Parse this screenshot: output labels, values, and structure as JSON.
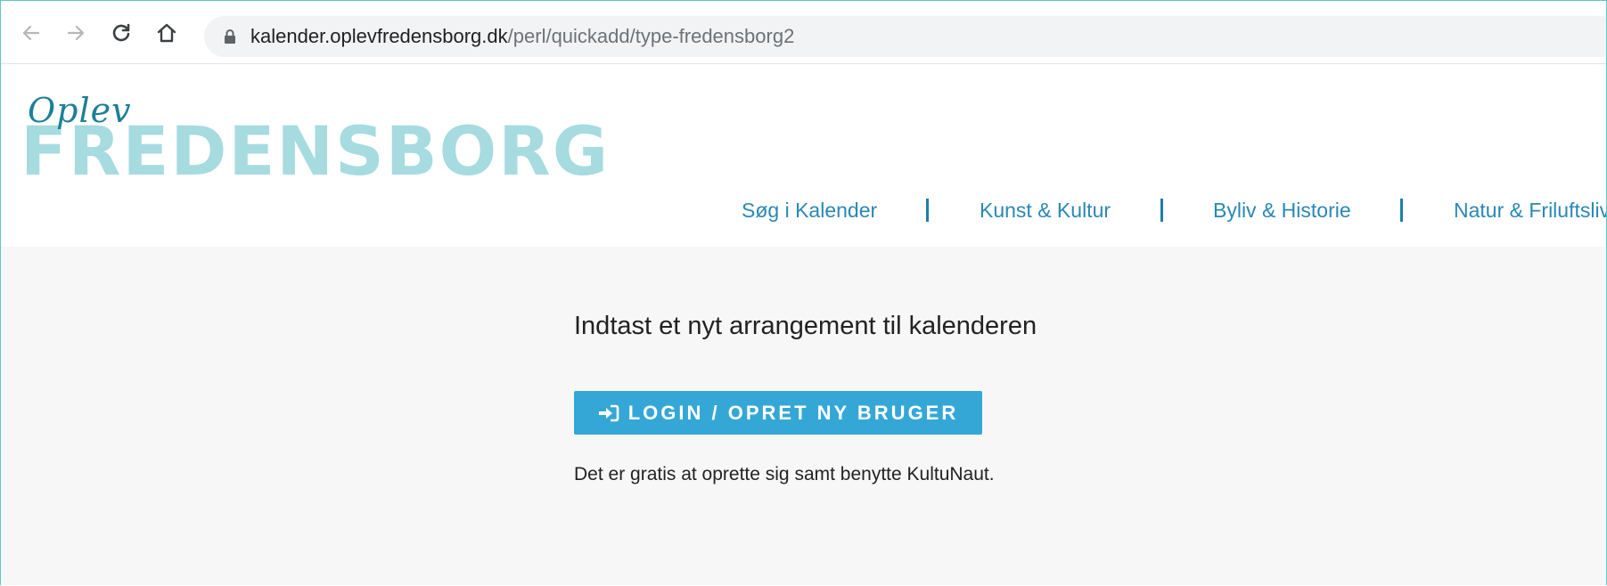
{
  "browser": {
    "url_host": "kalender.oplevfredensborg.dk",
    "url_path": "/perl/quickadd/type-fredensborg2",
    "icons": [
      "back-arrow-icon",
      "forward-arrow-icon",
      "reload-icon",
      "home-icon",
      "lock-icon"
    ]
  },
  "logo": {
    "script": "Oplev",
    "word": "FREDENSBORG",
    "colors": {
      "script": "#1e7f96",
      "word": "#a6dbe0"
    }
  },
  "nav": {
    "items": [
      {
        "label": "Søg i Kalender"
      },
      {
        "label": "Kunst & Kultur"
      },
      {
        "label": "Byliv & Historie"
      },
      {
        "label": "Natur & Friluftsliv"
      }
    ],
    "colors": {
      "link": "#2a88b4",
      "separator": "#1c7fa9"
    }
  },
  "main": {
    "heading": "Indtast et nyt arrangement til kalenderen",
    "login_button": {
      "label": "LOGIN / OPRET NY BRUGER",
      "icon": "sign-in-icon",
      "color": "#35a7d7"
    },
    "note": "Det er gratis at oprette sig samt benytte KultuNaut."
  }
}
